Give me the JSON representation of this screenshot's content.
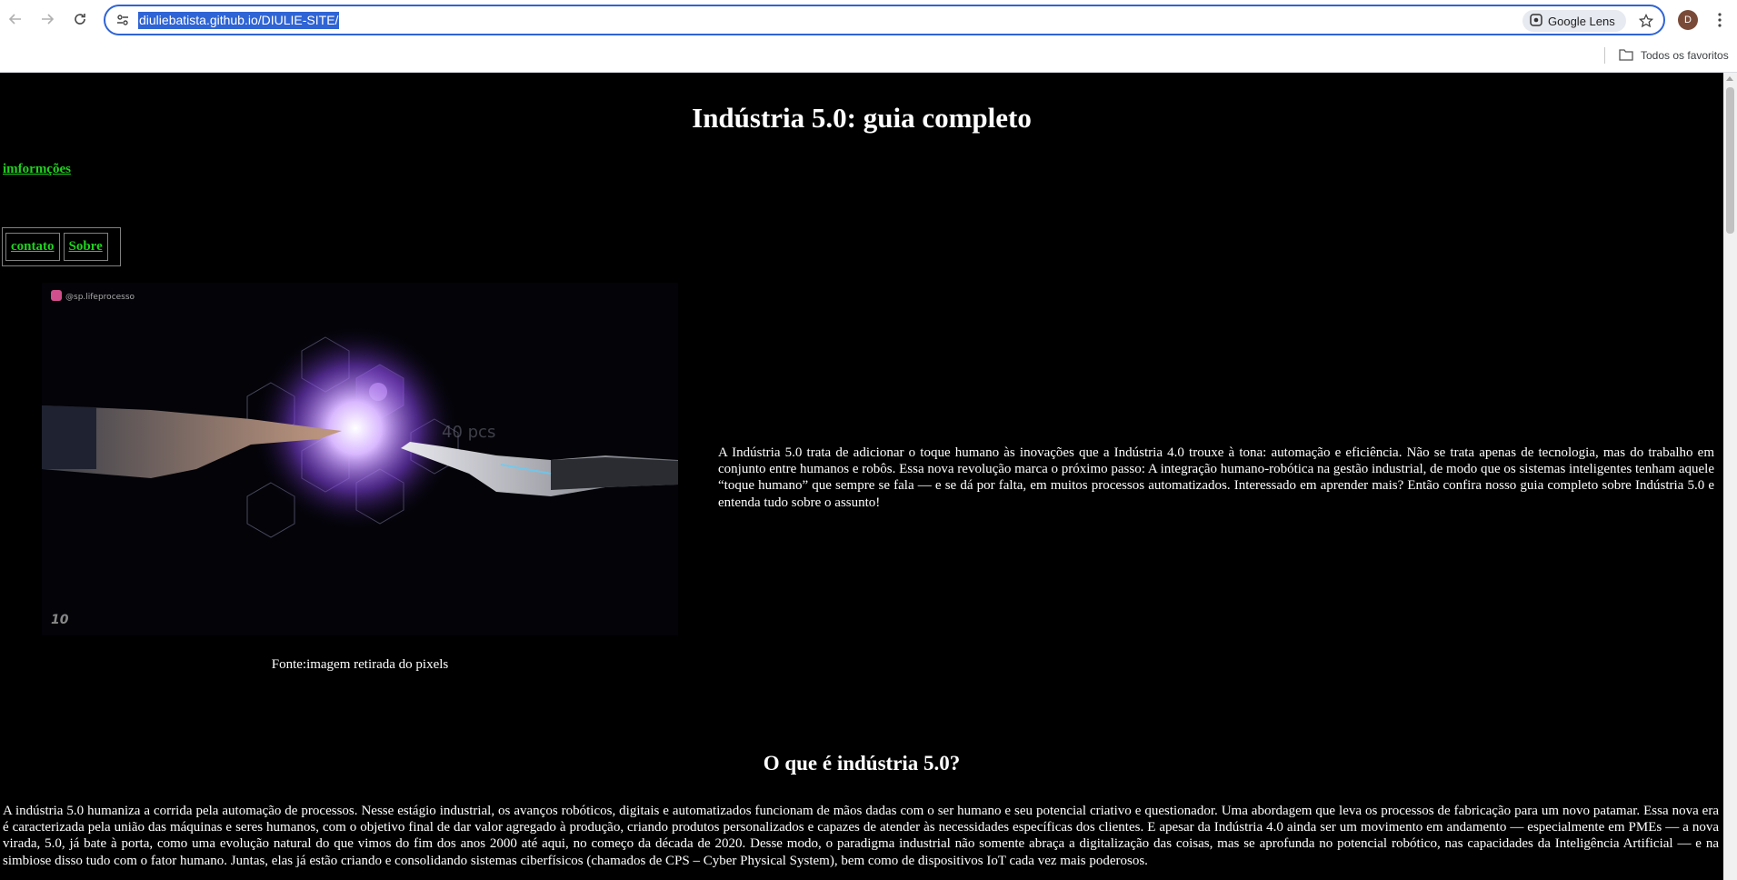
{
  "browser": {
    "url": "diuliebatista.github.io/DIULIE-SITE/",
    "lens_label": "Google Lens",
    "profile_initial": "D",
    "bookmarks_all_label": "Todos os favoritos"
  },
  "page": {
    "title": "Indústria 5.0: guia completo",
    "info_link": "imformções",
    "nav": [
      "contato",
      "Sobre"
    ],
    "image": {
      "watermark_tl": "@sp.lifeprocesso",
      "watermark_bl": "10",
      "overlay_text": "40 pcs"
    },
    "caption": "Fonte:imagem retirada do pixels",
    "intro": "A Indústria 5.0 trata de adicionar o toque humano às inovações que a Indústria 4.0 trouxe à tona: automação e eficiência. Não se trata apenas de tecnologia, mas do trabalho em conjunto entre humanos e robôs. Essa nova revolução marca o próximo passo: A integração humano-robótica na gestão industrial, de modo que os sistemas inteligentes tenham aquele “toque humano” que sempre se fala — e se dá por falta, em muitos processos automatizados. Interessado em aprender mais? Então confira nosso guia completo sobre Indústria 5.0 e entenda tudo sobre o assunto!",
    "section_title": "O que é indústria 5.0?",
    "section_text": "A indústria 5.0 humaniza a corrida pela automação de processos. Nesse estágio industrial, os avanços robóticos, digitais e automatizados funcionam de mãos dadas com o ser humano e seu potencial criativo e questionador. Uma abordagem que leva os processos de fabricação para um novo patamar. Essa nova era é caracterizada pela união das máquinas e seres humanos, com o objetivo final de dar valor agregado à produção, criando produtos personalizados e capazes de atender às necessidades específicas dos clientes. E apesar da Indústria 4.0 ainda ser um movimento em andamento — especialmente em PMEs — a nova virada, 5.0, já bate à porta, como uma evolução natural do que vimos do fim dos anos 2000 até aqui, no começo da década de 2020. Desse modo, o paradigma industrial não somente abraça a digitalização das coisas, mas se aprofunda no potencial robótico, nas capacidades da Inteligência Artificial — e na simbiose disso tudo com o fator humano. Juntas, elas já estão criando e consolidando sistemas ciberfísicos (chamados de CPS – Cyber Physical System), bem como de dispositivos IoT cada vez mais poderosos."
  },
  "colors": {
    "link": "#1fd21f",
    "page_bg": "#000000",
    "omnibox_border": "#2f64d4"
  }
}
